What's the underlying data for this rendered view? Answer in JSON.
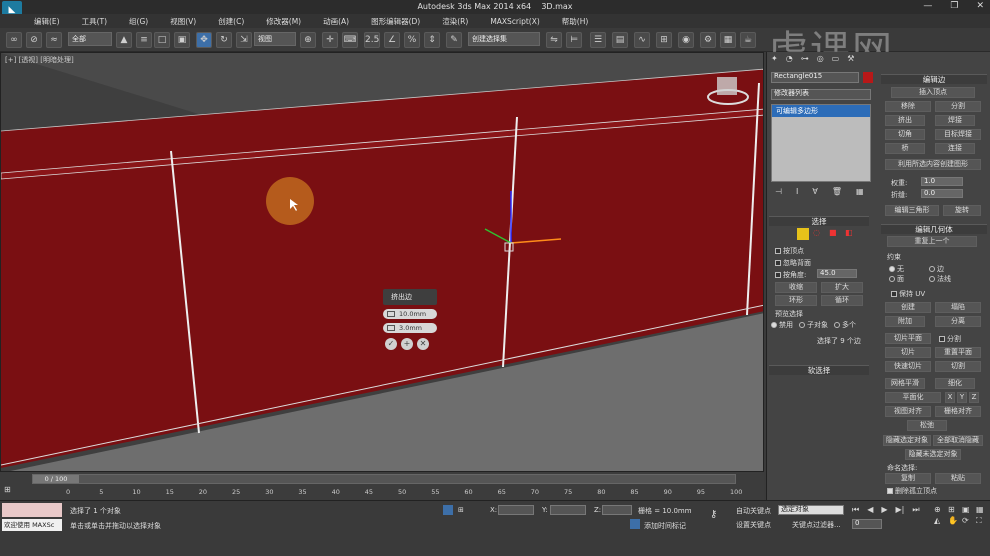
{
  "window": {
    "app_title": "Autodesk 3ds Max  2014 x64",
    "file_name": "3D.max"
  },
  "menu": [
    "编辑(E)",
    "工具(T)",
    "组(G)",
    "视图(V)",
    "创建(C)",
    "修改器(M)",
    "动画(A)",
    "图形编辑器(D)",
    "渲染(R)",
    "MAXScript(X)",
    "帮助(H)"
  ],
  "toolbar": {
    "filter_value": "全部",
    "ref_coord": "视图",
    "named_selection": "创建选择集"
  },
  "viewport": {
    "label": "[+] [透视] [明暗处理]"
  },
  "caddy": {
    "title": "挤出边",
    "height": "10.0mm",
    "width": "3.0mm"
  },
  "watermark": "虎课网",
  "panel": {
    "object_name": "Rectangle015",
    "modifier_list": "修改器列表",
    "stack_item": "可编辑多边形",
    "selection_title": "选择",
    "by_vertex": "按顶点",
    "ignore_backfacing": "忽略背面",
    "by_angle": "按角度:",
    "angle_value": "45.0",
    "shrink": "收缩",
    "grow": "扩大",
    "ring": "环形",
    "loop": "循环",
    "preview_selection": "预览选择",
    "preview_options": [
      "禁用",
      "子对象",
      "多个"
    ],
    "selected_count": "选择了 9 个边",
    "soft_selection": "软选择",
    "edit_edges_title": "编辑边",
    "insert_vertex": "插入顶点",
    "remove": "移除",
    "split": "分割",
    "extrude": "挤出",
    "weld": "焊接",
    "chamfer": "切角",
    "target_weld": "目标焊接",
    "bridge": "桥",
    "connect": "连接",
    "create_shape": "利用所选内容创建图形",
    "weight_label": "权重:",
    "weight_value": "1.0",
    "crease_label": "折缝:",
    "crease_value": "0.0",
    "edit_tri": "编辑三角形",
    "turn": "旋转",
    "edit_geo_title": "编辑几何体",
    "repeat_last": "重复上一个",
    "constraints_label": "约束",
    "constraints": [
      "无",
      "边",
      "面",
      "法线"
    ],
    "preserve_uv": "保持 UV",
    "create": "创建",
    "collapse": "塌陷",
    "attach": "附加",
    "detach": "分离",
    "slice_plane": "切片平面",
    "split2": "分割",
    "slice": "切片",
    "reset_plane": "重置平面",
    "quickslice": "快速切片",
    "cut": "切割",
    "meshsmooth": "网格平滑",
    "tessellate": "细化",
    "planarize": "平面化",
    "xyz": [
      "X",
      "Y",
      "Z"
    ],
    "view_align": "视图对齐",
    "grid_align": "栅格对齐",
    "relax": "松弛",
    "hide_selected": "隐藏选定对象",
    "unhide_all": "全部取消隐藏",
    "hide_unselected": "隐藏未选定对象",
    "named_selections": "命名选择:",
    "copy": "复制",
    "paste": "粘贴",
    "delete_isolated": "删除孤立顶点"
  },
  "timeline": {
    "frame": "0 / 100",
    "ticks": [
      "0",
      "5",
      "10",
      "15",
      "20",
      "25",
      "30",
      "35",
      "40",
      "45",
      "50",
      "55",
      "60",
      "65",
      "70",
      "75",
      "80",
      "85",
      "90",
      "95",
      "100"
    ]
  },
  "status": {
    "listener": "欢迎使用 MAXSc",
    "selected": "选择了 1 个对象",
    "prompt": "单击或单击并拖动以选择对象",
    "x_label": "X:",
    "y_label": "Y:",
    "z_label": "Z:",
    "grid": "栅格 = 10.0mm",
    "auto_key": "自动关键点",
    "selected_obj": "选定对象",
    "set_key": "设置关键点",
    "key_filters": "关键点过滤器...",
    "add_time_tag": "添加时间标记",
    "frame_value": "0"
  },
  "colors": {
    "wall": "#7a0f12",
    "accent": "#1d7ba0",
    "object_color": "#b81818"
  }
}
